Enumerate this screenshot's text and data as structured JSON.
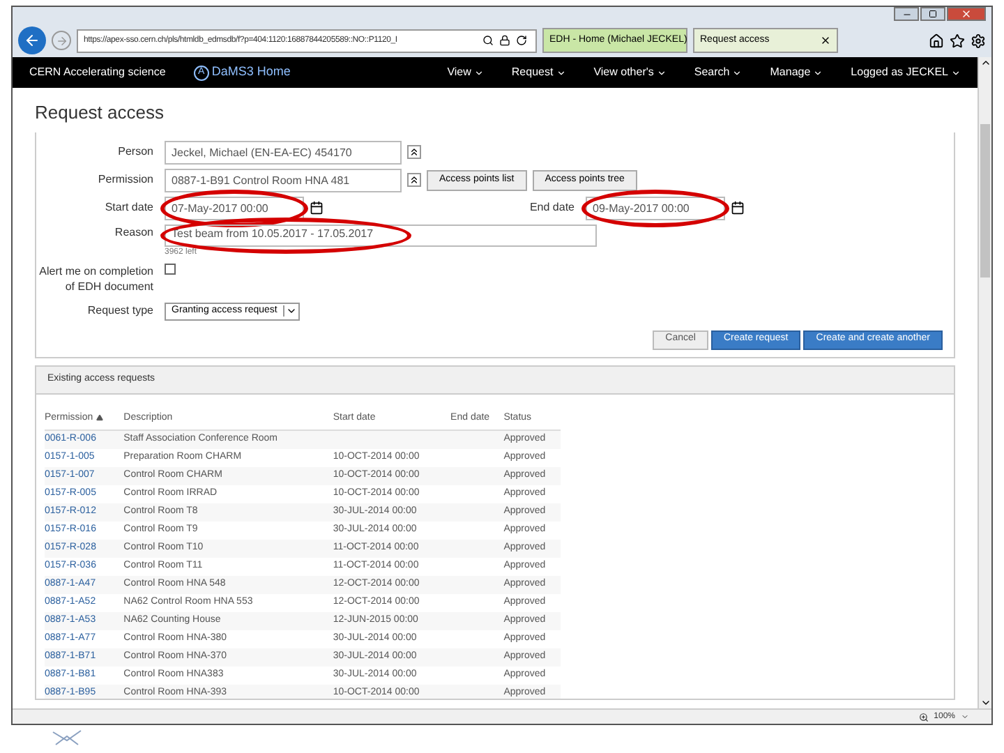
{
  "browser": {
    "url": "https://apex-sso.cern.ch/pls/htmldb_edmsdb/f?p=404:1120:16887844205589::NO::P1120_I",
    "tabs": [
      {
        "label": "EDH - Home (Michael JECKEL)",
        "selected": false
      },
      {
        "label": "Request access",
        "selected": true
      }
    ],
    "zoom": "100%"
  },
  "navbar": {
    "brand": "CERN Accelerating science",
    "logo_letter": "A",
    "home": "DaMS3 Home",
    "menus": [
      "View",
      "Request",
      "View other's",
      "Search",
      "Manage",
      "Logged as JECKEL"
    ]
  },
  "page_title": "Request access",
  "form": {
    "person": {
      "label": "Person",
      "value": "Jeckel, Michael (EN-EA-EC) 454170"
    },
    "permission": {
      "label": "Permission",
      "value": "0887-1-B91 Control Room HNA 481"
    },
    "permission_buttons": [
      "Access points list",
      "Access points tree"
    ],
    "start_date": {
      "label": "Start date",
      "value": "07-May-2017 00:00",
      "highlighted": true
    },
    "end_date": {
      "label": "End date",
      "value": "09-May-2017 00:00",
      "highlighted": true
    },
    "reason": {
      "label": "Reason",
      "value": "Test beam from 10.05.2017 - 17.05.2017",
      "highlighted": true,
      "counter": "3962 left"
    },
    "alert": {
      "label": "Alert me on completion of EDH document",
      "checked": false
    },
    "request_type": {
      "label": "Request type",
      "value": "Granting access request"
    },
    "buttons": [
      {
        "label": "Cancel",
        "kind": "secondary"
      },
      {
        "label": "Create request",
        "kind": "primary"
      },
      {
        "label": "Create and create another",
        "kind": "primary"
      }
    ]
  },
  "existing": {
    "title": "Existing access requests",
    "columns": [
      "Permission",
      "Description",
      "Start date",
      "End date",
      "Status"
    ],
    "rows": [
      [
        "0061-R-006",
        "Staff Association Conference Room",
        "",
        "",
        "Approved"
      ],
      [
        "0157-1-005",
        "Preparation Room CHARM",
        "10-OCT-2014 00:00",
        "",
        "Approved"
      ],
      [
        "0157-1-007",
        "Control Room CHARM",
        "10-OCT-2014 00:00",
        "",
        "Approved"
      ],
      [
        "0157-R-005",
        "Control Room IRRAD",
        "10-OCT-2014 00:00",
        "",
        "Approved"
      ],
      [
        "0157-R-012",
        "Control Room T8",
        "30-JUL-2014 00:00",
        "",
        "Approved"
      ],
      [
        "0157-R-016",
        "Control Room T9",
        "30-JUL-2014 00:00",
        "",
        "Approved"
      ],
      [
        "0157-R-028",
        "Control Room T10",
        "11-OCT-2014 00:00",
        "",
        "Approved"
      ],
      [
        "0157-R-036",
        "Control Room T11",
        "11-OCT-2014 00:00",
        "",
        "Approved"
      ],
      [
        "0887-1-A47",
        "Control Room HNA 548",
        "12-OCT-2014 00:00",
        "",
        "Approved"
      ],
      [
        "0887-1-A52",
        "NA62 Control Room HNA 553",
        "12-OCT-2014 00:00",
        "",
        "Approved"
      ],
      [
        "0887-1-A53",
        "NA62 Counting House",
        "12-JUN-2015 00:00",
        "",
        "Approved"
      ],
      [
        "0887-1-A77",
        "Control Room HNA-380",
        "30-JUL-2014 00:00",
        "",
        "Approved"
      ],
      [
        "0887-1-B71",
        "Control Room HNA-370",
        "30-JUL-2014 00:00",
        "",
        "Approved"
      ],
      [
        "0887-1-B81",
        "Control Room HNA383",
        "30-JUL-2014 00:00",
        "",
        "Approved"
      ],
      [
        "0887-1-B95",
        "Control Room HNA-393",
        "10-OCT-2014 00:00",
        "",
        "Approved"
      ]
    ]
  }
}
